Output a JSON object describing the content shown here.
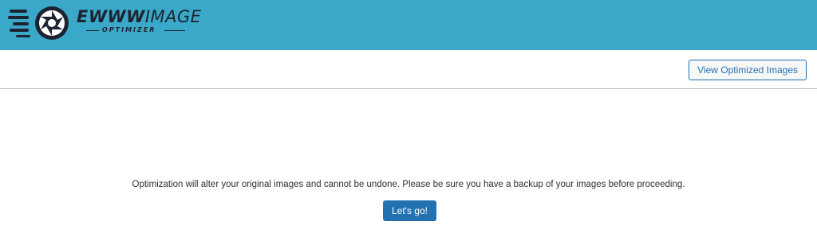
{
  "header": {
    "background_color": "#3aa9c9",
    "logo": {
      "icon": "camera-aperture-icon",
      "wordmark_bold": "EWWW",
      "wordmark_light": "IMAGE",
      "subtitle": "OPTIMIZER"
    }
  },
  "toolbar": {
    "view_button_label": "View Optimized Images"
  },
  "main": {
    "notice_text": "Optimization will alter your original images and cannot be undone. Please be sure you have a backup of your images before proceeding.",
    "start_button_label": "Let's go!",
    "accent_color": "#2271b1"
  }
}
